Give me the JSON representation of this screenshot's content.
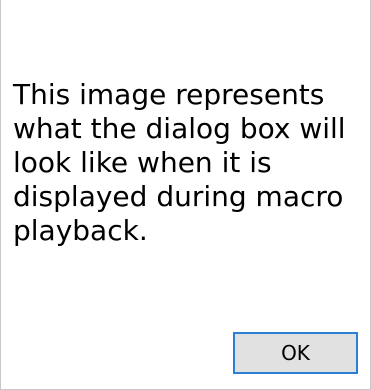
{
  "dialog": {
    "message": "This image represents\nwhat the dialog box will\nlook like when it is\ndisplayed during macro\nplayback.",
    "ok_label": "OK"
  },
  "colors": {
    "background": "#ffffff",
    "button_face": "#e1e1e1",
    "button_focus_border": "#2b7fd4",
    "text": "#000000"
  }
}
